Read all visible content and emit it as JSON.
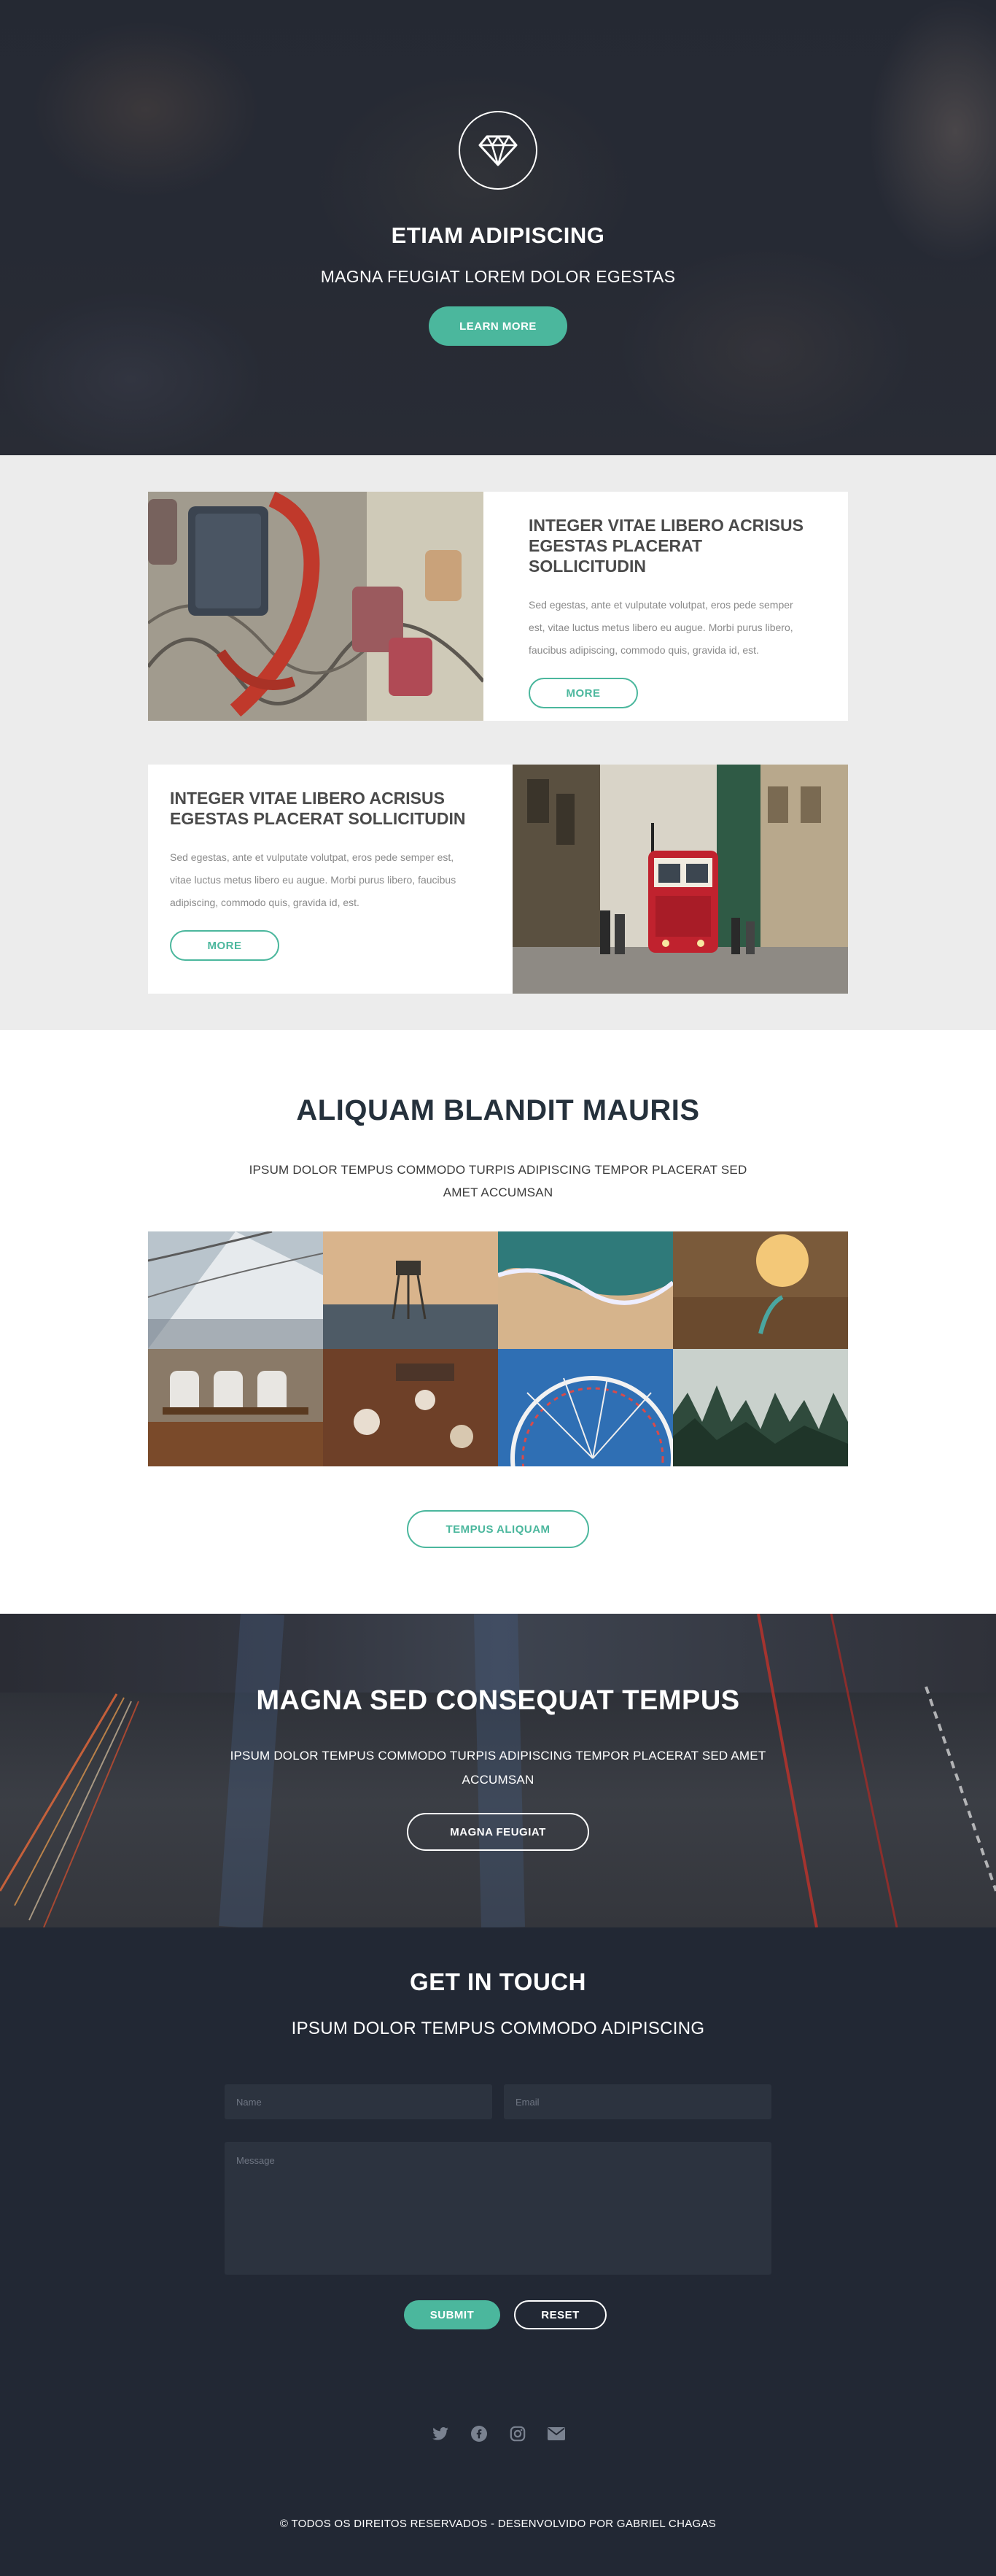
{
  "hero": {
    "icon": "diamond-icon",
    "title": "ETIAM ADIPISCING",
    "subtitle": "MAGNA FEUGIAT LOREM DOLOR EGESTAS",
    "button_label": "LEARN MORE"
  },
  "features": [
    {
      "image": "padlocks-photo",
      "title": "INTEGER VITAE LIBERO ACRISUS EGESTAS PLACERAT SOLLICITUDIN",
      "text": "Sed egestas, ante et vulputate volutpat, eros pede semper est, vitae luctus metus libero eu augue. Morbi purus libero, faucibus adipiscing, commodo quis, gravida id, est.",
      "button_label": "MORE"
    },
    {
      "image": "red-tram-photo",
      "title": "INTEGER VITAE LIBERO ACRISUS EGESTAS PLACERAT SOLLICITUDIN",
      "text": "Sed egestas, ante et vulputate volutpat, eros pede semper est, vitae luctus metus libero eu augue. Morbi purus libero, faucibus adipiscing, commodo quis, gravida id, est.",
      "button_label": "MORE"
    }
  ],
  "gallery": {
    "title": "ALIQUAM BLANDIT MAURIS",
    "subtitle": "IPSUM DOLOR TEMPUS COMMODO TURPIS ADIPISCING TEMPOR PLACERAT SED AMET ACCUMSAN",
    "thumbnails": [
      "sail-photo",
      "lifeguard-tower-photo",
      "beach-waves-photo",
      "surfboard-sunset-photo",
      "dining-chairs-photo",
      "coffee-table-photo",
      "ferris-wheel-photo",
      "misty-forest-photo"
    ],
    "button_label": "TEMPUS ALIQUAM"
  },
  "banner": {
    "title": "MAGNA SED CONSEQUAT TEMPUS",
    "subtitle": "IPSUM DOLOR TEMPUS COMMODO TURPIS ADIPISCING TEMPOR PLACERAT SED AMET ACCUMSAN",
    "button_label": "MAGNA FEUGIAT"
  },
  "contact": {
    "title": "GET IN TOUCH",
    "subtitle": "IPSUM DOLOR TEMPUS COMMODO ADIPISCING",
    "name_placeholder": "Name",
    "email_placeholder": "Email",
    "message_placeholder": "Message",
    "submit_label": "SUBMIT",
    "reset_label": "RESET",
    "socials": [
      "twitter-icon",
      "facebook-icon",
      "instagram-icon",
      "envelope-icon"
    ]
  },
  "footer": {
    "text": "© TODOS OS DIREITOS RESERVADOS - DESENVOLVIDO POR GABRIEL CHAGAS"
  },
  "colors": {
    "accent": "#4bb79d",
    "dark": "#222834",
    "section_gray": "#ececec"
  }
}
